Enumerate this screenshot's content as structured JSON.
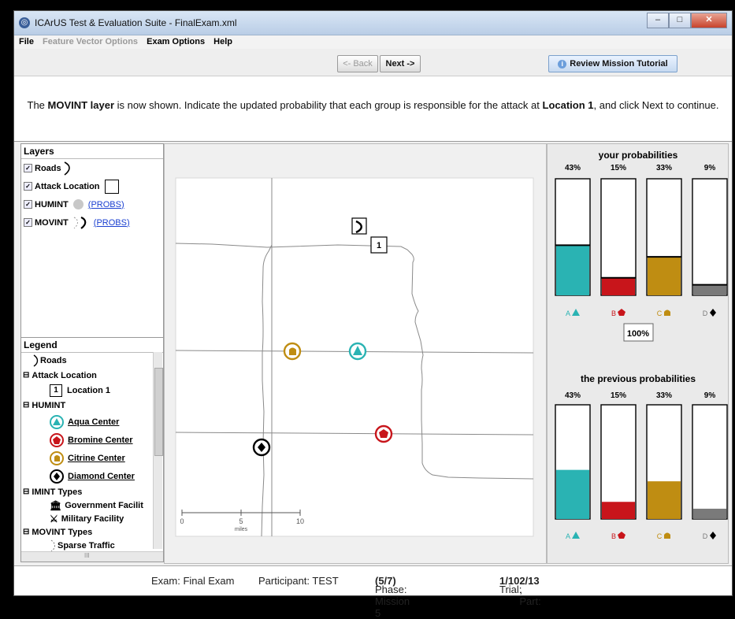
{
  "window": {
    "title": "ICArUS Test & Evaluation Suite - FinalExam.xml",
    "minimize": "–",
    "maximize": "□",
    "close": "✕"
  },
  "menu": {
    "file": "File",
    "feature_vector": "Feature Vector Options",
    "exam_options": "Exam Options",
    "help": "Help"
  },
  "nav": {
    "back": "<- Back",
    "next": "Next ->",
    "tutorial": "Review Mission Tutorial"
  },
  "instruction": {
    "p1": "The ",
    "b1": "MOVINT layer",
    "p2": " is now shown. Indicate the updated probability that each group is responsible for the attack at ",
    "b2": "Location 1",
    "p3": ", and click Next to continue."
  },
  "layers": {
    "header": "Layers",
    "roads": "Roads",
    "attack": "Attack Location",
    "humint": "HUMINT",
    "movint": "MOVINT",
    "probs_link": "(PROBS)"
  },
  "legend": {
    "header": "Legend",
    "roads": "Roads",
    "attack_location": "Attack Location",
    "location1": "Location 1",
    "location1_num": "1",
    "humint": "HUMINT",
    "aqua": "Aqua Center",
    "bromine": "Bromine Center",
    "citrine": "Citrine Center",
    "diamond": "Diamond Center",
    "imint": "IMINT Types",
    "gov": "Government Facilit",
    "mil": "Military Facility",
    "movint": "MOVINT Types",
    "sparse": "Sparse Traffic",
    "scroll_mark": "III"
  },
  "map": {
    "attack_label": "1",
    "scale_ticks": [
      "0",
      "5",
      "10"
    ],
    "scale_unit": "miles"
  },
  "probabilities": {
    "your_title": "your probabilities",
    "prev_title": "the previous probabilities",
    "total": "100%",
    "groups": [
      {
        "letter": "A",
        "color": "#2ab3b3",
        "your": 43,
        "prev": 43,
        "your_label": "43%",
        "prev_label": "43%"
      },
      {
        "letter": "B",
        "color": "#c8151b",
        "your": 15,
        "prev": 15,
        "your_label": "15%",
        "prev_label": "15%"
      },
      {
        "letter": "C",
        "color": "#bf8d12",
        "your": 33,
        "prev": 33,
        "your_label": "33%",
        "prev_label": "33%"
      },
      {
        "letter": "D",
        "color": "#7a7a7a",
        "your": 9,
        "prev": 9,
        "your_label": "9%",
        "prev_label": "9%"
      }
    ]
  },
  "status": {
    "exam": "Exam: Final Exam",
    "participant": "Participant: TEST",
    "phase_pre": "Phase: Mission 5 ",
    "phase_b": "(5/7)",
    "trial_pre": "Trial: ",
    "trial_b": "1/10",
    "part_pre": ", Part: ",
    "part_b": "2/13"
  }
}
